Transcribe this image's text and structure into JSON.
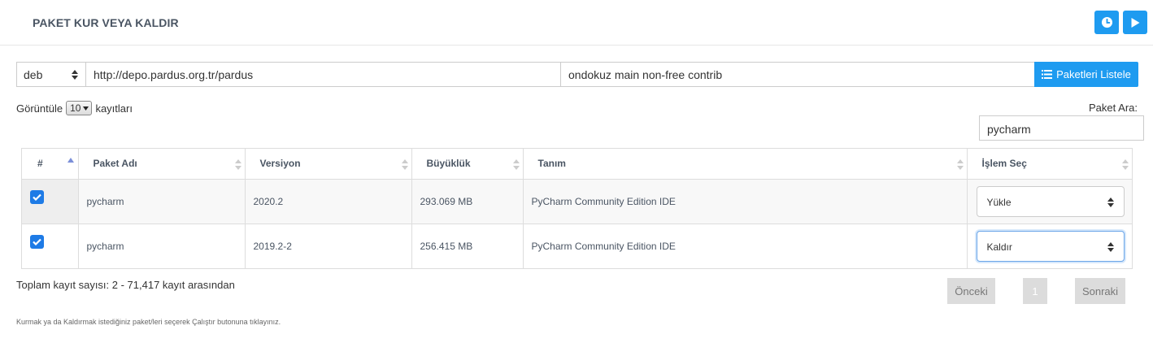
{
  "header": {
    "title": "PAKET KUR VEYA KALDIR",
    "history_icon": "clock-icon",
    "run_icon": "play-icon",
    "accent": "#1e9bf0"
  },
  "repo": {
    "type": "deb",
    "url": "http://depo.pardus.org.tr/pardus",
    "components": "ondokuz main non-free contrib",
    "list_button": "Paketleri Listele"
  },
  "length": {
    "prefix": "Görüntüle",
    "value": "10",
    "suffix": "kayıtları"
  },
  "search": {
    "label": "Paket Ara:",
    "value": "pycharm"
  },
  "table": {
    "columns": [
      "#",
      "Paket Adı",
      "Versiyon",
      "Büyüklük",
      "Tanım",
      "İşlem Seç"
    ],
    "rows": [
      {
        "checked": true,
        "name": "pycharm",
        "version": "2020.2",
        "size": "293.069 MB",
        "description": "PyCharm Community Edition IDE",
        "action": "Yükle"
      },
      {
        "checked": true,
        "name": "pycharm",
        "version": "2019.2-2",
        "size": "256.415 MB",
        "description": "PyCharm Community Edition IDE",
        "action": "Kaldır"
      }
    ]
  },
  "footer": {
    "info": "Toplam kayıt sayısı: 2 - 71,417 kayıt arasından",
    "prev": "Önceki",
    "page": "1",
    "next": "Sonraki",
    "note": "Kurmak ya da Kaldırmak istediğiniz paket/leri seçerek Çalıştır butonuna tıklayınız."
  }
}
